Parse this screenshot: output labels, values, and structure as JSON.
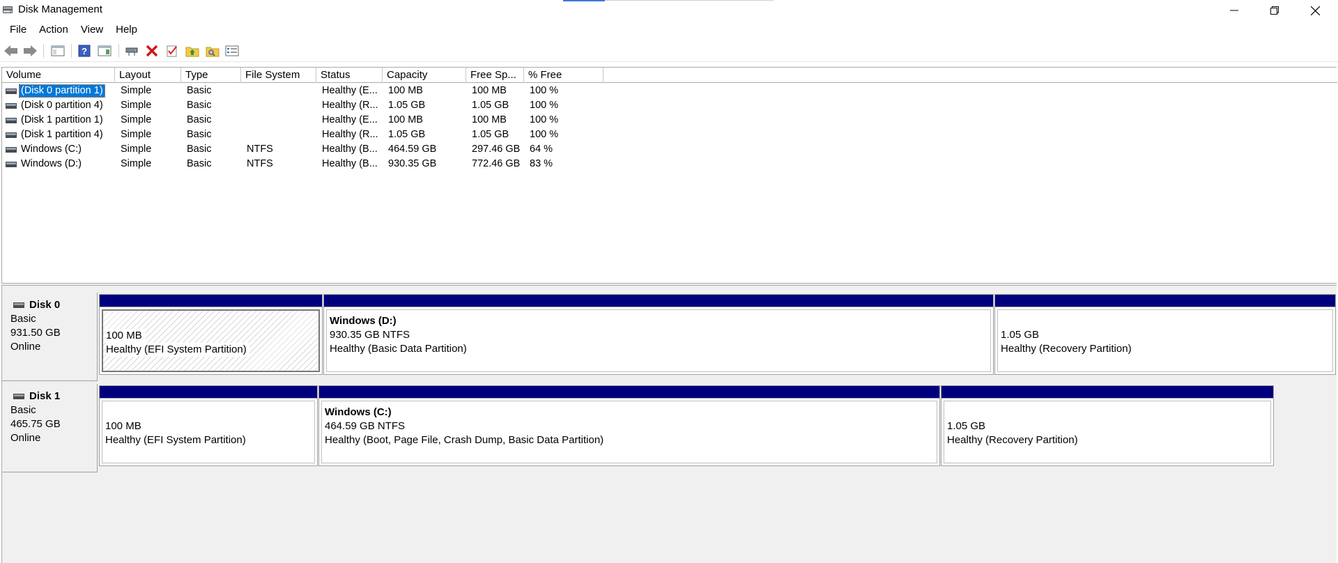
{
  "window": {
    "title": "Disk Management",
    "controls": {
      "minimize": "minimize",
      "restore": "restore",
      "close": "close"
    }
  },
  "menu": [
    "File",
    "Action",
    "View",
    "Help"
  ],
  "toolbar": {
    "buttons": [
      "back-arrow",
      "forward-arrow",
      "console-tree",
      "help",
      "show-hide-action-pane",
      "connect-disk",
      "delete",
      "properties-check",
      "folder-up",
      "folder-search",
      "settings-list"
    ]
  },
  "volume_list": {
    "columns": [
      "Volume",
      "Layout",
      "Type",
      "File System",
      "Status",
      "Capacity",
      "Free Sp...",
      "% Free"
    ],
    "rows": [
      {
        "volume": "(Disk 0 partition 1)",
        "layout": "Simple",
        "type": "Basic",
        "fs": "",
        "status": "Healthy (E...",
        "capacity": "100 MB",
        "free": "100 MB",
        "pct": "100 %",
        "selected": true
      },
      {
        "volume": "(Disk 0 partition 4)",
        "layout": "Simple",
        "type": "Basic",
        "fs": "",
        "status": "Healthy (R...",
        "capacity": "1.05 GB",
        "free": "1.05 GB",
        "pct": "100 %"
      },
      {
        "volume": "(Disk 1 partition 1)",
        "layout": "Simple",
        "type": "Basic",
        "fs": "",
        "status": "Healthy (E...",
        "capacity": "100 MB",
        "free": "100 MB",
        "pct": "100 %"
      },
      {
        "volume": "(Disk 1 partition 4)",
        "layout": "Simple",
        "type": "Basic",
        "fs": "",
        "status": "Healthy (R...",
        "capacity": "1.05 GB",
        "free": "1.05 GB",
        "pct": "100 %"
      },
      {
        "volume": "Windows (C:)",
        "layout": "Simple",
        "type": "Basic",
        "fs": "NTFS",
        "status": "Healthy (B...",
        "capacity": "464.59 GB",
        "free": "297.46 GB",
        "pct": "64 %"
      },
      {
        "volume": "Windows (D:)",
        "layout": "Simple",
        "type": "Basic",
        "fs": "NTFS",
        "status": "Healthy (B...",
        "capacity": "930.35 GB",
        "free": "772.46 GB",
        "pct": "83 %"
      }
    ]
  },
  "disks": [
    {
      "name": "Disk 0",
      "type": "Basic",
      "size": "931.50 GB",
      "state": "Online",
      "partitions": [
        {
          "title": "",
          "size": "100 MB",
          "status": "Healthy (EFI System Partition)",
          "selected": true
        },
        {
          "title": "Windows  (D:)",
          "size": "930.35 GB NTFS",
          "status": "Healthy (Basic Data Partition)"
        },
        {
          "title": "",
          "size": "1.05 GB",
          "status": "Healthy (Recovery Partition)"
        }
      ]
    },
    {
      "name": "Disk 1",
      "type": "Basic",
      "size": "465.75 GB",
      "state": "Online",
      "partitions": [
        {
          "title": "",
          "size": "100 MB",
          "status": "Healthy (EFI System Partition)"
        },
        {
          "title": "Windows  (C:)",
          "size": "464.59 GB NTFS",
          "status": "Healthy (Boot, Page File, Crash Dump, Basic Data Partition)"
        },
        {
          "title": "",
          "size": "1.05 GB",
          "status": "Healthy (Recovery Partition)"
        }
      ]
    }
  ],
  "colors": {
    "partition_bar": "#00007f",
    "selection": "#0078d7",
    "background": "#f0f0f0"
  }
}
